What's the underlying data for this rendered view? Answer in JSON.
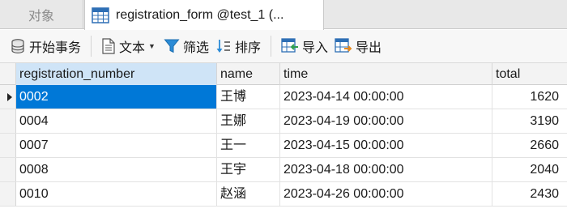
{
  "tabs": {
    "objects_label": "对象",
    "active_label": "registration_form @test_1 (..."
  },
  "toolbar": {
    "begin_transaction": "开始事务",
    "text": "文本",
    "filter": "筛选",
    "sort": "排序",
    "import": "导入",
    "export": "导出"
  },
  "table": {
    "columns": [
      "registration_number",
      "name",
      "time",
      "total"
    ],
    "rows": [
      {
        "registration_number": "0002",
        "name": "王博",
        "time": "2023-04-14 00:00:00",
        "total": "1620"
      },
      {
        "registration_number": "0004",
        "name": "王娜",
        "time": "2023-04-19 00:00:00",
        "total": "3190"
      },
      {
        "registration_number": "0007",
        "name": "王一",
        "time": "2023-04-15 00:00:00",
        "total": "2660"
      },
      {
        "registration_number": "0008",
        "name": "王宇",
        "time": "2023-04-18 00:00:00",
        "total": "2040"
      },
      {
        "registration_number": "0010",
        "name": "赵涵",
        "time": "2023-04-26 00:00:00",
        "total": "2430"
      }
    ],
    "selected_row": 0,
    "selected_column": "registration_number"
  },
  "colors": {
    "selection": "#0078d7",
    "header_selected": "#cfe4f7",
    "filter_icon": "#2b8bd6",
    "import_icon": "#2e9e4f",
    "export_icon": "#e8891c"
  }
}
